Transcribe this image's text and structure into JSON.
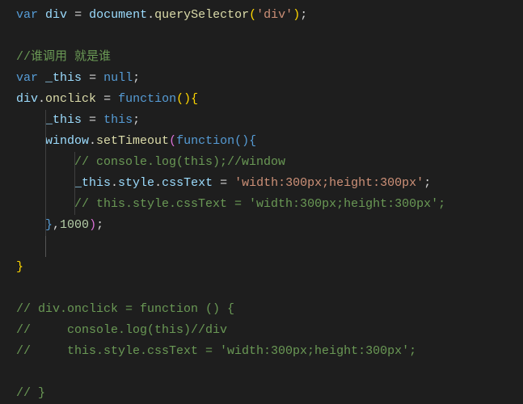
{
  "code": {
    "lines": [
      {
        "i": 0,
        "tokens": [
          {
            "c": "kw",
            "t": "var"
          },
          {
            "c": "pn",
            "t": " "
          },
          {
            "c": "vr",
            "t": "div"
          },
          {
            "c": "pn",
            "t": " "
          },
          {
            "c": "op",
            "t": "="
          },
          {
            "c": "pn",
            "t": " "
          },
          {
            "c": "vr",
            "t": "document"
          },
          {
            "c": "pn",
            "t": "."
          },
          {
            "c": "fn",
            "t": "querySelector"
          },
          {
            "c": "br1",
            "t": "("
          },
          {
            "c": "str",
            "t": "'div'"
          },
          {
            "c": "br1",
            "t": ")"
          },
          {
            "c": "pn",
            "t": ";"
          }
        ]
      },
      {
        "i": 1,
        "tokens": [
          {
            "c": "pn",
            "t": " "
          }
        ]
      },
      {
        "i": 2,
        "tokens": [
          {
            "c": "cm",
            "t": "//谁调用 就是谁"
          }
        ]
      },
      {
        "i": 3,
        "tokens": [
          {
            "c": "kw",
            "t": "var"
          },
          {
            "c": "pn",
            "t": " "
          },
          {
            "c": "vr",
            "t": "_this"
          },
          {
            "c": "pn",
            "t": " "
          },
          {
            "c": "op",
            "t": "="
          },
          {
            "c": "pn",
            "t": " "
          },
          {
            "c": "kw",
            "t": "null"
          },
          {
            "c": "pn",
            "t": ";"
          }
        ]
      },
      {
        "i": 4,
        "tokens": [
          {
            "c": "vr",
            "t": "div"
          },
          {
            "c": "pn",
            "t": "."
          },
          {
            "c": "fn",
            "t": "onclick"
          },
          {
            "c": "pn",
            "t": " "
          },
          {
            "c": "op",
            "t": "="
          },
          {
            "c": "pn",
            "t": " "
          },
          {
            "c": "kw",
            "t": "function"
          },
          {
            "c": "br1",
            "t": "()"
          },
          {
            "c": "br1",
            "t": "{"
          }
        ]
      },
      {
        "i": 5,
        "guides": [
          "g2"
        ],
        "tokens": [
          {
            "c": "pn",
            "t": "    "
          },
          {
            "c": "vr",
            "t": "_this"
          },
          {
            "c": "pn",
            "t": " "
          },
          {
            "c": "op",
            "t": "="
          },
          {
            "c": "pn",
            "t": " "
          },
          {
            "c": "kw",
            "t": "this"
          },
          {
            "c": "pn",
            "t": ";"
          }
        ]
      },
      {
        "i": 6,
        "guides": [
          "g2"
        ],
        "tokens": [
          {
            "c": "pn",
            "t": "    "
          },
          {
            "c": "vr",
            "t": "window"
          },
          {
            "c": "pn",
            "t": "."
          },
          {
            "c": "fn",
            "t": "setTimeout"
          },
          {
            "c": "br2",
            "t": "("
          },
          {
            "c": "kw",
            "t": "function"
          },
          {
            "c": "br3",
            "t": "()"
          },
          {
            "c": "br3",
            "t": "{"
          }
        ]
      },
      {
        "i": 7,
        "guides": [
          "g2",
          "g3"
        ],
        "tokens": [
          {
            "c": "pn",
            "t": "        "
          },
          {
            "c": "cm",
            "t": "// console.log(this);//window"
          }
        ]
      },
      {
        "i": 8,
        "guides": [
          "g2",
          "g3"
        ],
        "tokens": [
          {
            "c": "pn",
            "t": "        "
          },
          {
            "c": "vr",
            "t": "_this"
          },
          {
            "c": "pn",
            "t": "."
          },
          {
            "c": "vr",
            "t": "style"
          },
          {
            "c": "pn",
            "t": "."
          },
          {
            "c": "vr",
            "t": "cssText"
          },
          {
            "c": "pn",
            "t": " "
          },
          {
            "c": "op",
            "t": "="
          },
          {
            "c": "pn",
            "t": " "
          },
          {
            "c": "str",
            "t": "'width:300px;height:300px'"
          },
          {
            "c": "pn",
            "t": ";"
          }
        ]
      },
      {
        "i": 9,
        "guides": [
          "g2",
          "g3"
        ],
        "tokens": [
          {
            "c": "pn",
            "t": "        "
          },
          {
            "c": "cm",
            "t": "// this.style.cssText = 'width:300px;height:300px';"
          }
        ]
      },
      {
        "i": 10,
        "guides": [
          "g2"
        ],
        "tokens": [
          {
            "c": "pn",
            "t": "    "
          },
          {
            "c": "br3",
            "t": "}"
          },
          {
            "c": "pn",
            "t": ","
          },
          {
            "c": "num",
            "t": "1000"
          },
          {
            "c": "br2",
            "t": ")"
          },
          {
            "c": "pn",
            "t": ";"
          }
        ]
      },
      {
        "i": 11,
        "guides": [
          "g2 ga"
        ],
        "tokens": [
          {
            "c": "pn",
            "t": " "
          }
        ]
      },
      {
        "i": 12,
        "tokens": [
          {
            "c": "br1",
            "t": "}"
          }
        ]
      },
      {
        "i": 13,
        "tokens": [
          {
            "c": "pn",
            "t": " "
          }
        ]
      },
      {
        "i": 14,
        "tokens": [
          {
            "c": "cm",
            "t": "// div.onclick = function () {"
          }
        ]
      },
      {
        "i": 15,
        "tokens": [
          {
            "c": "cm",
            "t": "//     console.log(this)//div"
          }
        ]
      },
      {
        "i": 16,
        "tokens": [
          {
            "c": "cm",
            "t": "//     this.style.cssText = 'width:300px;height:300px';"
          }
        ]
      },
      {
        "i": 17,
        "tokens": [
          {
            "c": "pn",
            "t": " "
          }
        ]
      },
      {
        "i": 18,
        "tokens": [
          {
            "c": "cm",
            "t": "// }"
          }
        ]
      }
    ]
  }
}
